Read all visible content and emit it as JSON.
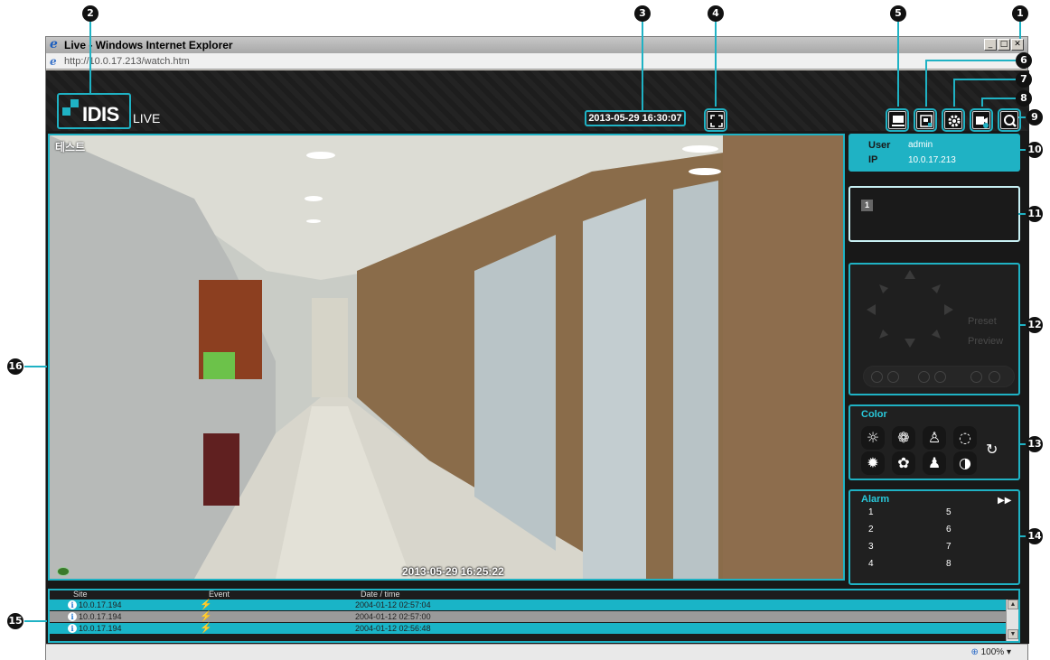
{
  "browser": {
    "title": "Live - Windows Internet Explorer",
    "url": "http://10.0.17.213/watch.htm",
    "status_zoom": "100%"
  },
  "header": {
    "logo_text": "IDIS",
    "logo_sub": "LIVE",
    "datetime": "2013-05-29 16:30:07"
  },
  "video": {
    "camera_title": "테스트",
    "timestamp": "2013-05-29 16:25:22"
  },
  "user_panel": {
    "user_label": "User",
    "user_value": "admin",
    "ip_label": "IP",
    "ip_value": "10.0.17.213"
  },
  "layout_panel": {
    "channel": "1"
  },
  "ptz_panel": {
    "preset_label": "Preset",
    "preview_label": "Preview"
  },
  "color_panel": {
    "title": "Color"
  },
  "alarm_panel": {
    "title": "Alarm",
    "numbers": [
      "1",
      "2",
      "3",
      "4",
      "5",
      "6",
      "7",
      "8"
    ]
  },
  "event_log": {
    "columns": [
      "Site",
      "Event",
      "Date / time"
    ],
    "rows": [
      {
        "site": "10.0.17.194",
        "datetime": "2004-01-12 02:57:04"
      },
      {
        "site": "10.0.17.194",
        "datetime": "2004-01-12 02:57:00"
      },
      {
        "site": "10.0.17.194",
        "datetime": "2004-01-12 02:56:48"
      }
    ]
  },
  "callouts": [
    "1",
    "2",
    "3",
    "4",
    "5",
    "6",
    "7",
    "8",
    "9",
    "10",
    "11",
    "12",
    "13",
    "14",
    "15",
    "16"
  ],
  "colors": {
    "accent": "#1fb2c4",
    "background": "#181818",
    "log_gray": "#9a9a9a"
  }
}
